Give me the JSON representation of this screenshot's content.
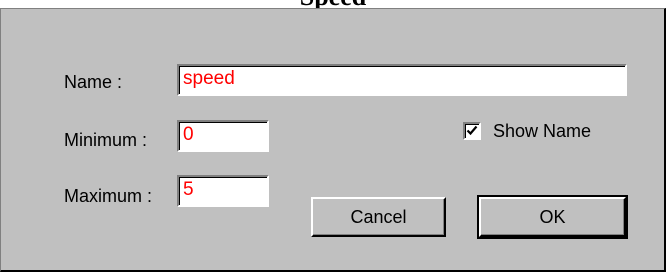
{
  "window": {
    "title": "Speed"
  },
  "form": {
    "name_label": "Name :",
    "name_value": "speed",
    "minimum_label": "Minimum :",
    "minimum_value": "0",
    "maximum_label": "Maximum :",
    "maximum_value": "5",
    "show_name_label": "Show Name",
    "show_name_checked": true
  },
  "buttons": {
    "cancel_label": "Cancel",
    "ok_label": "OK"
  },
  "colors": {
    "dialog_bg": "#c0c0c0",
    "field_text": "#ff0000"
  }
}
